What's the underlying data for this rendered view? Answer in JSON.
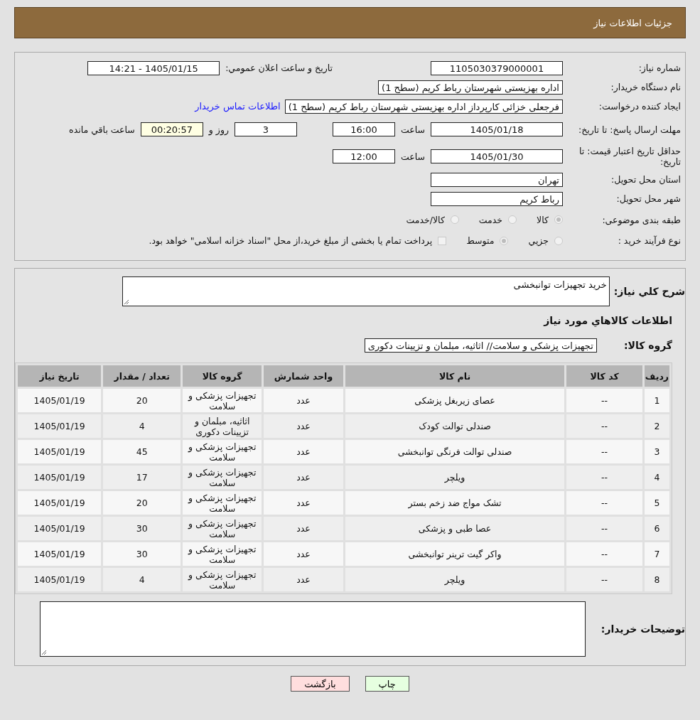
{
  "header": {
    "title": "جزئیات اطلاعات نیاز"
  },
  "need_number": {
    "label": "شماره نیاز:",
    "value": "1105030379000001"
  },
  "announce": {
    "label": "تاریخ و ساعت اعلان عمومي:",
    "value": "1405/01/15 - 14:21"
  },
  "buyer": {
    "label": "نام دستگاه خریدار:",
    "value": "اداره بهزیستی شهرستان رباط کریم (سطح 1)"
  },
  "requester": {
    "label": "ایجاد کننده درخواست:",
    "value": "فرجعلی خزائی کارپرداز اداره بهزیستی شهرستان رباط کریم (سطح 1)",
    "link": "اطلاعات تماس خریدار"
  },
  "reply_deadline": {
    "label": "مهلت ارسال پاسخ: تا تاریخ:",
    "date": "1405/01/18",
    "time_label": "ساعت",
    "time": "16:00",
    "days": "3",
    "days_label": "روز و",
    "remaining": "00:20:57",
    "remaining_label": "ساعت باقي مانده"
  },
  "price_validity": {
    "label": "حداقل تاریخ اعتبار قیمت: تا تاریخ:",
    "date": "1405/01/30",
    "time_label": "ساعت",
    "time": "12:00"
  },
  "province": {
    "label": "استان محل تحویل:",
    "value": "تهران"
  },
  "city": {
    "label": "شهر محل تحویل:",
    "value": "رباط کریم"
  },
  "category": {
    "label": "طبقه بندی موضوعی:",
    "options": [
      {
        "label": "کالا",
        "selected": true
      },
      {
        "label": "خدمت",
        "selected": false
      },
      {
        "label": "کالا/خدمت",
        "selected": false
      }
    ]
  },
  "process": {
    "label": "نوع فرآیند خرید :",
    "options": [
      {
        "label": "جزيي",
        "selected": false
      },
      {
        "label": "متوسط",
        "selected": true
      }
    ],
    "treasury": {
      "label": "پرداخت تمام یا بخشی از مبلغ خرید،از محل \"اسناد خزانه اسلامی\" خواهد بود.",
      "checked": false
    }
  },
  "description": {
    "label": "شرح كلي نياز:",
    "value": "خرید تجهیزات توانبخشی"
  },
  "items_heading": "اطلاعات كالاهاي مورد نياز",
  "goods_group": {
    "label": "گروه کالا:",
    "value": "تجهیزات پزشکی و سلامت// اثاثیه، مبلمان و تزیینات دکوری"
  },
  "table": {
    "columns": [
      "ردیف",
      "کد کالا",
      "نام کالا",
      "واحد شمارش",
      "گروه کالا",
      "تعداد / مقدار",
      "تاریخ نیاز"
    ],
    "rows": [
      [
        "1",
        "--",
        "عصای زیربغل پزشکی",
        "عدد",
        "تجهیزات پزشکی و سلامت",
        "20",
        "1405/01/19"
      ],
      [
        "2",
        "--",
        "صندلی توالت کودک",
        "عدد",
        "اثاثیه، مبلمان و تزیینات دکوری",
        "4",
        "1405/01/19"
      ],
      [
        "3",
        "--",
        "صندلی توالت فرنگی توانبخشی",
        "عدد",
        "تجهیزات پزشکی و سلامت",
        "45",
        "1405/01/19"
      ],
      [
        "4",
        "--",
        "ویلچر",
        "عدد",
        "تجهیزات پزشکی و سلامت",
        "17",
        "1405/01/19"
      ],
      [
        "5",
        "--",
        "تشک مواج ضد زخم بستر",
        "عدد",
        "تجهیزات پزشکی و سلامت",
        "20",
        "1405/01/19"
      ],
      [
        "6",
        "--",
        "عصا طبی و پزشکی",
        "عدد",
        "تجهیزات پزشکی و سلامت",
        "30",
        "1405/01/19"
      ],
      [
        "7",
        "--",
        "واکر گیت ترینر توانبخشی",
        "عدد",
        "تجهیزات پزشکی و سلامت",
        "30",
        "1405/01/19"
      ],
      [
        "8",
        "--",
        "ویلچر",
        "عدد",
        "تجهیزات پزشکی و سلامت",
        "4",
        "1405/01/19"
      ]
    ]
  },
  "buyer_notes": {
    "label": "توضیحات خریدار:"
  },
  "buttons": [
    {
      "label": "چاپ",
      "kind": "print"
    },
    {
      "label": "بازگشت",
      "kind": "back"
    }
  ]
}
